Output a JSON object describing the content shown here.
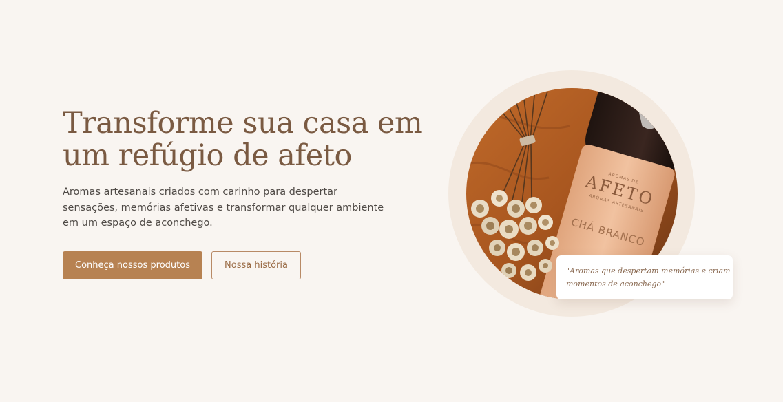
{
  "hero": {
    "title_line1": "Transforme sua casa em",
    "title_line2": "um refúgio de afeto",
    "description_line1": "Aromas artesanais criados com carinho para despertar",
    "description_line2": "sensações, memórias afetivas e transformar qualquer ambiente",
    "description_line3": "em um espaço de aconchego.",
    "primary_button_label": "Conheça nossos produtos",
    "secondary_button_label": "Nossa história"
  },
  "product_image": {
    "label_small_top": "AROMAS DE",
    "label_brand": "AFETO",
    "label_small_bottom": "AROMAS ARTESANAIS",
    "label_scent": "CHÁ BRANCO"
  },
  "quote": {
    "line1": "\"Aromas que despertam memórias e criam",
    "line2": "momentos de aconchego\""
  },
  "colors": {
    "background": "#f9f5f1",
    "title": "#7a5a42",
    "body_text": "#4f4a46",
    "accent": "#b78252",
    "ring": "#f3e9df"
  }
}
